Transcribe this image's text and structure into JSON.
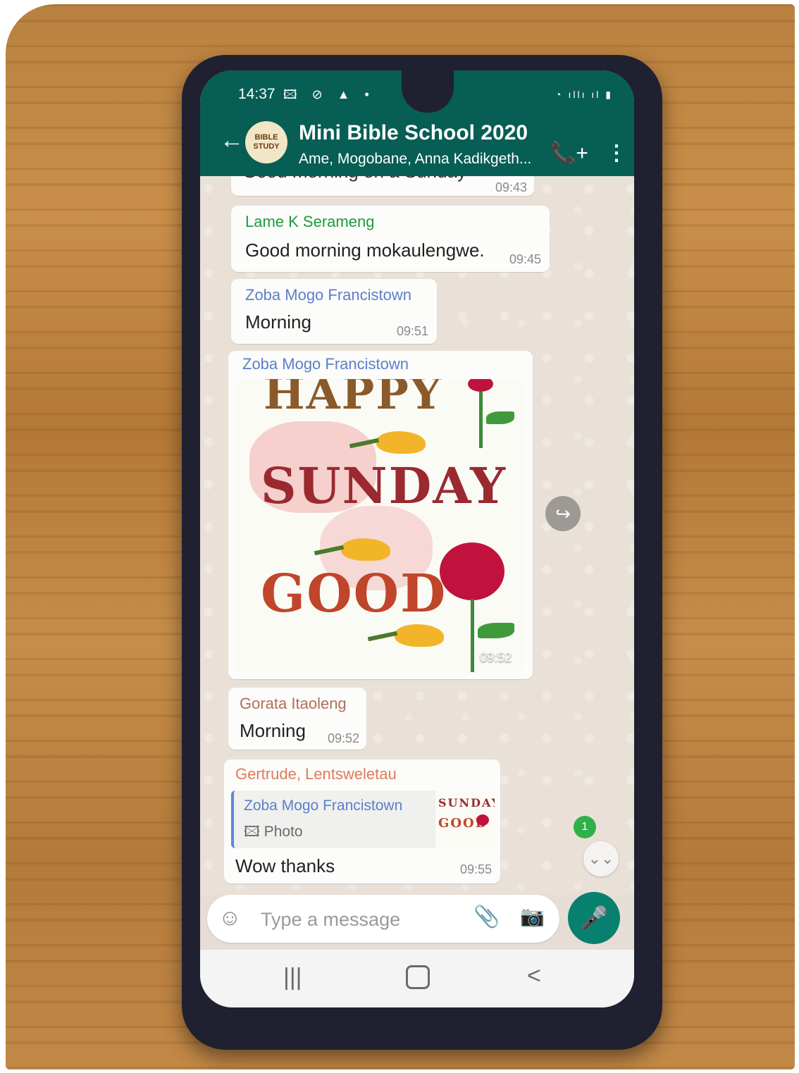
{
  "status": {
    "time": "14:37",
    "left_icons": "🖾 ⊘ ▲ •",
    "right_icons": "◔ ıllı ıl ▮"
  },
  "header": {
    "back": "←",
    "avatar_text": "BIBLE STUDY",
    "title": "Mini Bible School 2020",
    "subtitle": "Ame, Mogobane, Anna Kadikgeth...",
    "add_call": "📞+",
    "menu": "⋮"
  },
  "messages": [
    {
      "text": "Good morning on a Sunday",
      "time": "09:43"
    },
    {
      "sender": "Lame K Serameng",
      "text": "Good morning mokaulengwe.",
      "time": "09:45"
    },
    {
      "sender": "Zoba Mogo Francistown",
      "text": "Morning",
      "time": "09:51"
    },
    {
      "sender": "Zoba Mogo Francistown",
      "image_words": [
        "HAPPY",
        "SUNDAY",
        "GOOD"
      ],
      "time": "09:52"
    },
    {
      "sender": "Gorata Itaoleng",
      "text": "Morning",
      "time": "09:52"
    },
    {
      "sender": "Gertrude, Lentsweletau",
      "quote": {
        "author": "Zoba Mogo Francistown",
        "type": "🖾 Photo",
        "thumb_words": [
          "SUNDAY",
          "GOOD"
        ]
      },
      "text": "Wow thanks",
      "time": "09:55"
    }
  ],
  "colors": {
    "header": "#075e54",
    "lame_sender": "#1f9a3e",
    "zoba_sender": "#5b7fc9",
    "gorata_sender": "#b0705a",
    "gertrude_sender": "#e07a5a"
  },
  "forward_icon": "↪",
  "scroll": {
    "badge": "1",
    "icon": "⌄⌄"
  },
  "input": {
    "placeholder": "Type a message",
    "emoji_icon": "☺",
    "attach_icon": "📎",
    "camera_icon": "📷",
    "mic_icon": "🎤"
  },
  "nav": {
    "recents": "|||",
    "back": "<"
  }
}
